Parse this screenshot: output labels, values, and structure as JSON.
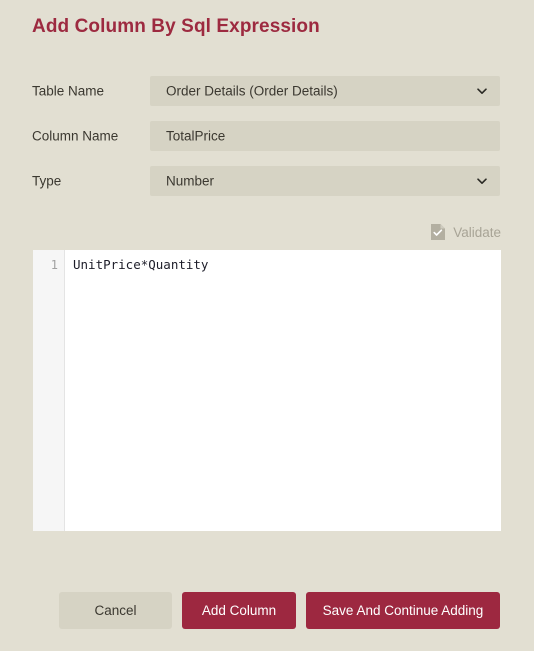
{
  "dialog": {
    "title": "Add Column By Sql Expression"
  },
  "form": {
    "rows": [
      {
        "label": "Table Name",
        "value": "Order Details (Order Details)",
        "control": "select",
        "icon": "chevron-down-icon"
      },
      {
        "label": "Column Name",
        "value": "TotalPrice",
        "placeholder": "",
        "control": "text"
      },
      {
        "label": "Type",
        "value": "Number",
        "control": "select",
        "icon": "chevron-down-icon"
      }
    ]
  },
  "validate": {
    "label": "Validate",
    "icon": "document-check-icon",
    "disabled": true
  },
  "editor": {
    "line_numbers": [
      "1"
    ],
    "lines": [
      "UnitPrice*Quantity"
    ]
  },
  "footer": {
    "cancel_label": "Cancel",
    "add_column_label": "Add Column",
    "save_continue_label": "Save And Continue Adding"
  },
  "colors": {
    "page_background": "#e2dfd2",
    "field_background": "#d6d3c4",
    "accent": "#9d2840",
    "title": "#9d2a40",
    "editor_background": "#ffffff",
    "gutter_background": "#f6f6f6",
    "disabled_text": "#a8a496",
    "code_text": "#1d1d29"
  }
}
